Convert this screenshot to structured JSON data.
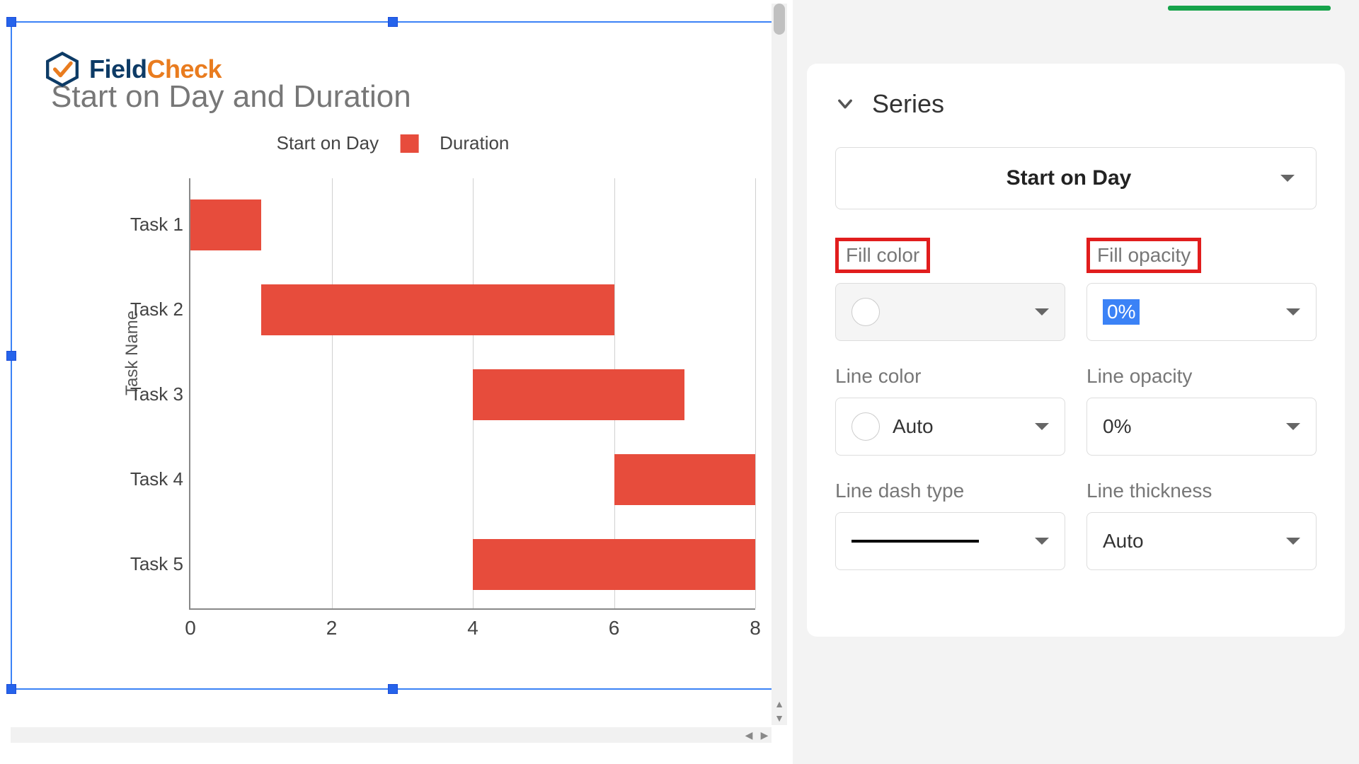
{
  "logo": {
    "part1": "Field",
    "part2": "Check"
  },
  "chart_data": {
    "type": "bar",
    "orientation": "horizontal",
    "stacked": true,
    "title": "Start on Day and Duration",
    "ylabel": "Task Name",
    "xlabel": "",
    "xlim": [
      0,
      8
    ],
    "x_ticks": [
      0,
      2,
      4,
      6,
      8
    ],
    "categories": [
      "Task 1",
      "Task 2",
      "Task 3",
      "Task 4",
      "Task 5"
    ],
    "series": [
      {
        "name": "Start on Day",
        "values": [
          0,
          1,
          4,
          6,
          4
        ],
        "fill_opacity": 0
      },
      {
        "name": "Duration",
        "values": [
          1,
          5,
          3,
          2,
          4
        ],
        "color": "#e74c3c"
      }
    ],
    "legend_visible_items": [
      "Start on Day",
      "Duration"
    ]
  },
  "sidebar": {
    "section_title": "Series",
    "series_selector": "Start on Day",
    "fields": {
      "fill_color": {
        "label": "Fill color",
        "value": ""
      },
      "fill_opacity": {
        "label": "Fill opacity",
        "value": "0%"
      },
      "line_color": {
        "label": "Line color",
        "value": "Auto"
      },
      "line_opacity": {
        "label": "Line opacity",
        "value": "0%"
      },
      "line_dash": {
        "label": "Line dash type",
        "value": "solid"
      },
      "line_thick": {
        "label": "Line thickness",
        "value": "Auto"
      }
    }
  }
}
